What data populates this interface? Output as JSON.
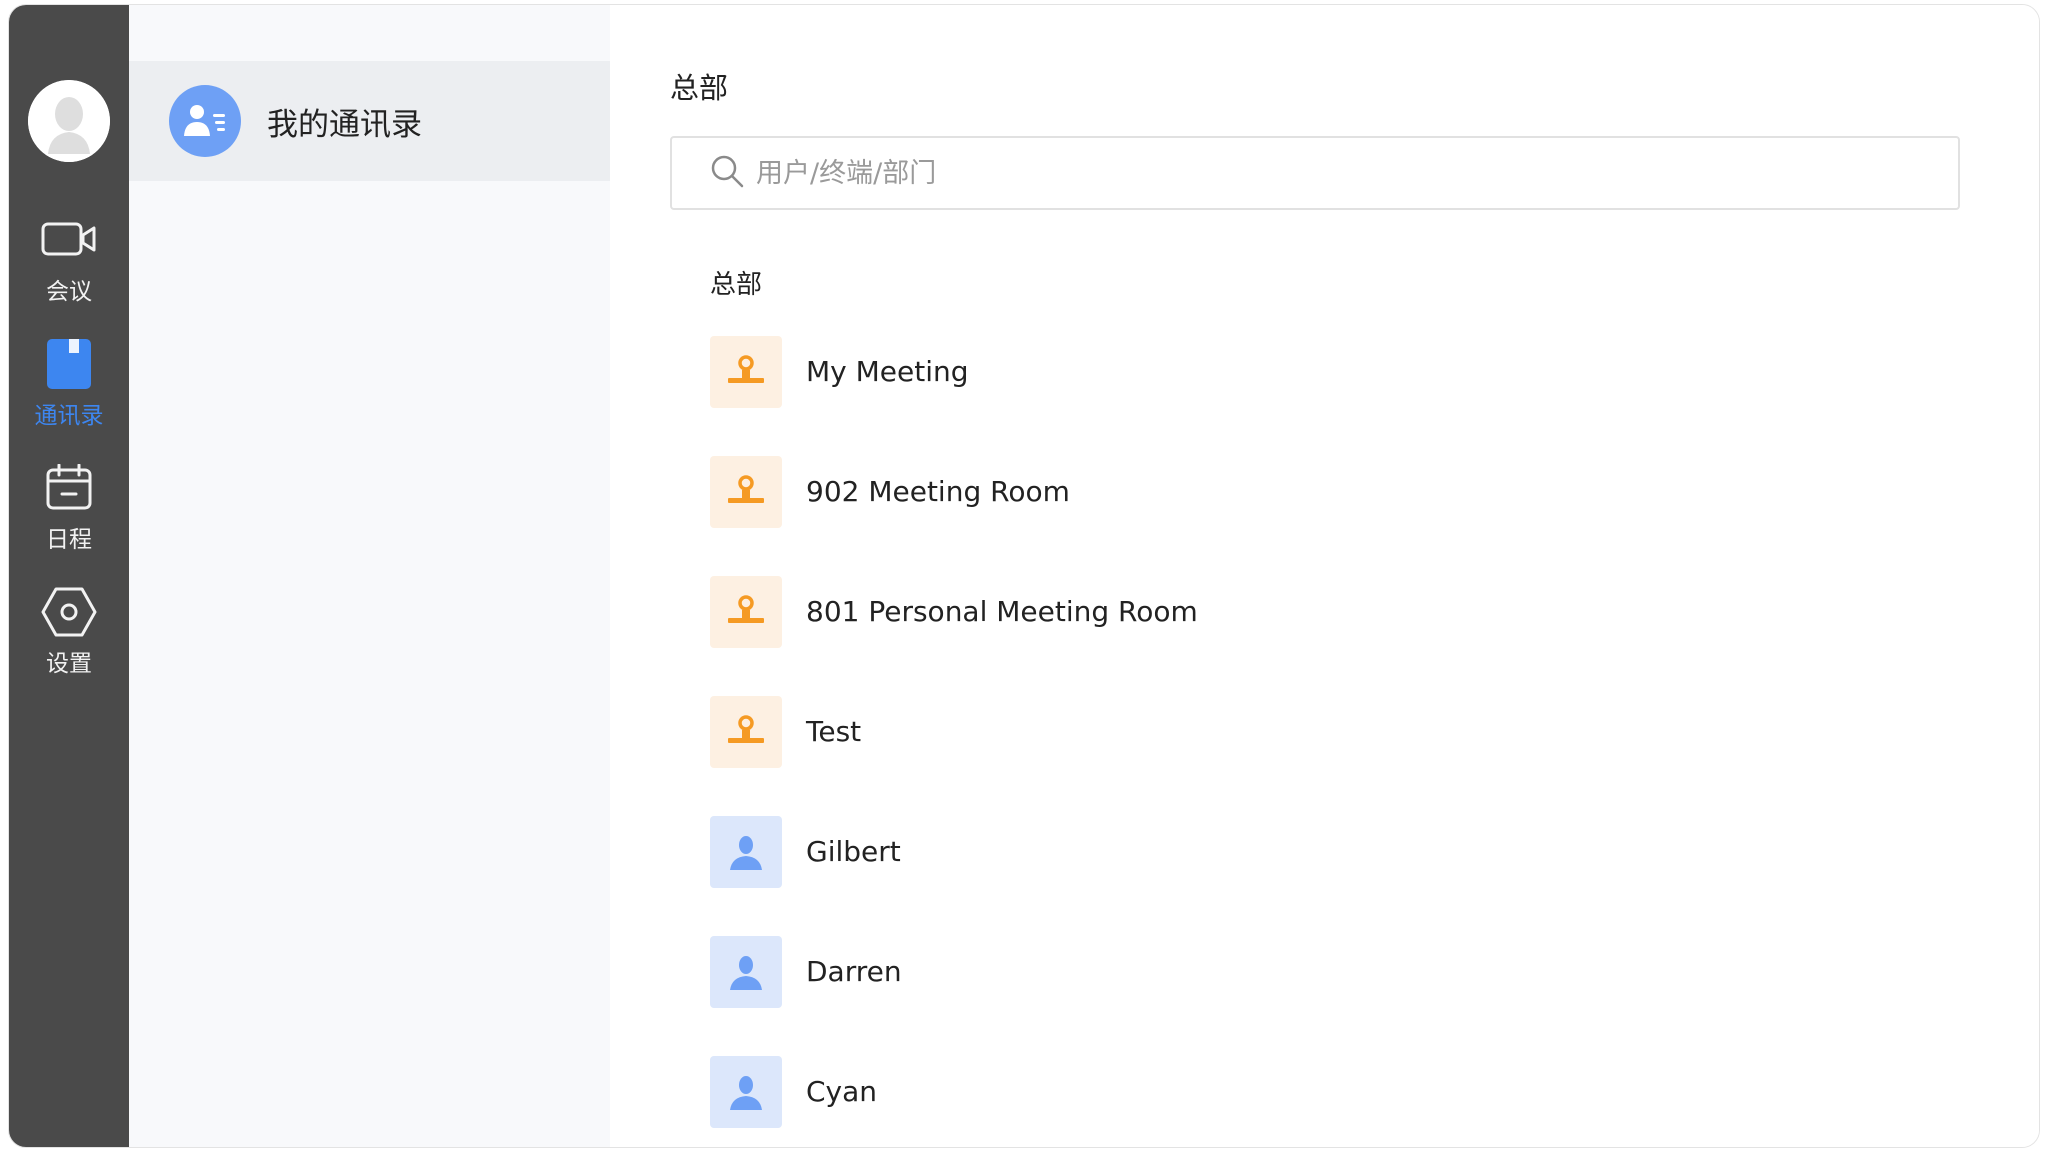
{
  "nav": {
    "items": [
      {
        "id": "meeting",
        "label": "会议"
      },
      {
        "id": "contacts",
        "label": "通讯录"
      },
      {
        "id": "schedule",
        "label": "日程"
      },
      {
        "id": "settings",
        "label": "设置"
      }
    ],
    "active": "contacts",
    "active_color": "#3d86f0"
  },
  "sidebar": {
    "my_contacts_label": "我的通讯录"
  },
  "main": {
    "title": "总部",
    "search": {
      "placeholder": "用户/终端/部门",
      "value": ""
    },
    "section_label": "总部",
    "entries": [
      {
        "name": "My Meeting",
        "kind": "room",
        "icon": "meeting-room-icon"
      },
      {
        "name": "902 Meeting Room",
        "kind": "room",
        "icon": "meeting-room-icon"
      },
      {
        "name": "801 Personal Meeting Room",
        "kind": "room",
        "icon": "meeting-room-icon"
      },
      {
        "name": "Test",
        "kind": "room",
        "icon": "meeting-room-icon"
      },
      {
        "name": "Gilbert",
        "kind": "user",
        "icon": "user-icon"
      },
      {
        "name": "Darren",
        "kind": "user",
        "icon": "user-icon"
      },
      {
        "name": "Cyan",
        "kind": "user",
        "icon": "user-icon"
      }
    ]
  },
  "colors": {
    "rail_bg": "#4a4a4a",
    "room_icon": "#f59a23",
    "room_bg": "#fdf0e2",
    "user_icon": "#6ea0f5",
    "user_bg": "#dce7fb"
  }
}
